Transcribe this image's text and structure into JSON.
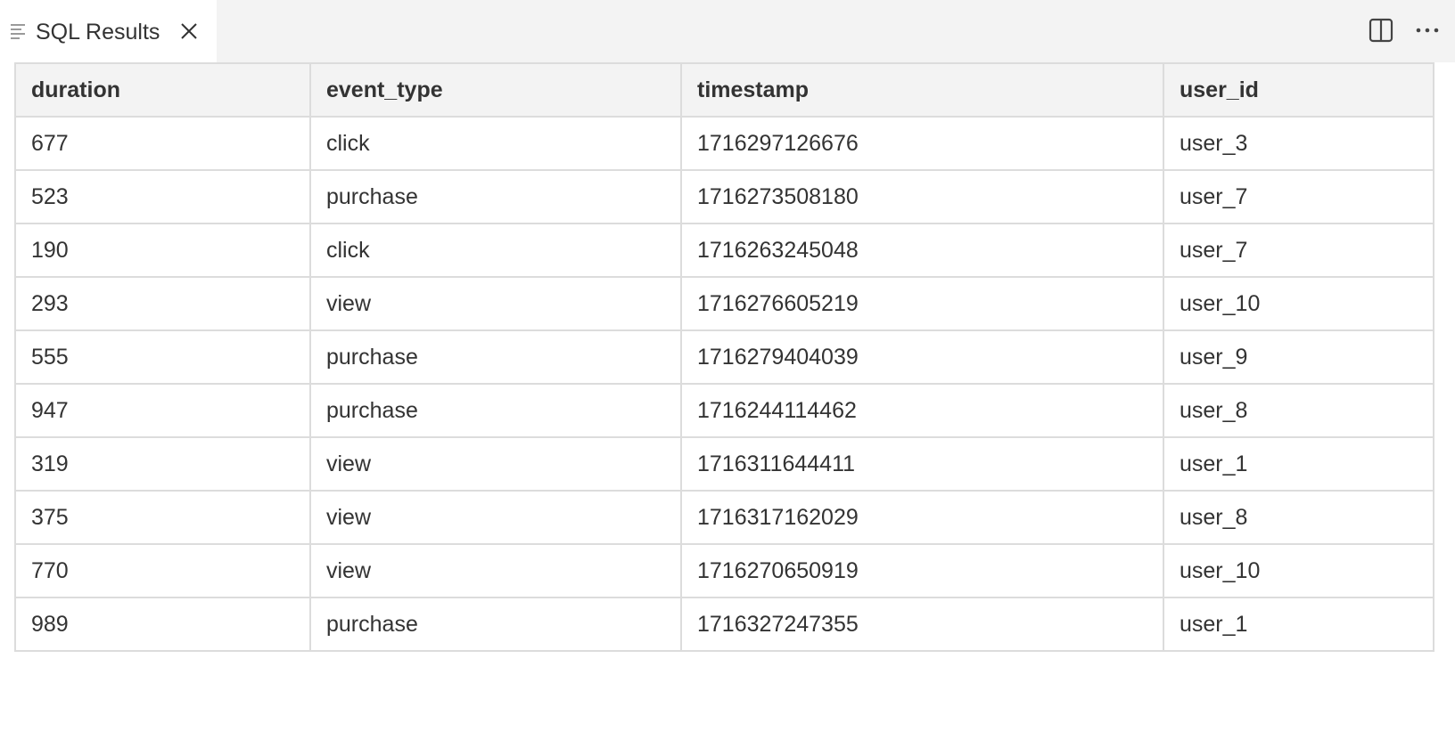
{
  "tab": {
    "label": "SQL Results",
    "icon": "text-lines-icon",
    "close_icon": "close-icon"
  },
  "toolbar": {
    "split_icon": "split-editor-icon",
    "more_icon": "more-actions-icon"
  },
  "colors": {
    "tabbar_bg": "#f3f3f3",
    "header_bg": "#f3f3f3",
    "border": "#dcdcdc",
    "text": "#333333"
  },
  "table": {
    "columns": [
      "duration",
      "event_type",
      "timestamp",
      "user_id"
    ],
    "rows": [
      [
        "677",
        "click",
        "1716297126676",
        "user_3"
      ],
      [
        "523",
        "purchase",
        "1716273508180",
        "user_7"
      ],
      [
        "190",
        "click",
        "1716263245048",
        "user_7"
      ],
      [
        "293",
        "view",
        "1716276605219",
        "user_10"
      ],
      [
        "555",
        "purchase",
        "1716279404039",
        "user_9"
      ],
      [
        "947",
        "purchase",
        "1716244114462",
        "user_8"
      ],
      [
        "319",
        "view",
        "1716311644411",
        "user_1"
      ],
      [
        "375",
        "view",
        "1716317162029",
        "user_8"
      ],
      [
        "770",
        "view",
        "1716270650919",
        "user_10"
      ],
      [
        "989",
        "purchase",
        "1716327247355",
        "user_1"
      ]
    ]
  }
}
